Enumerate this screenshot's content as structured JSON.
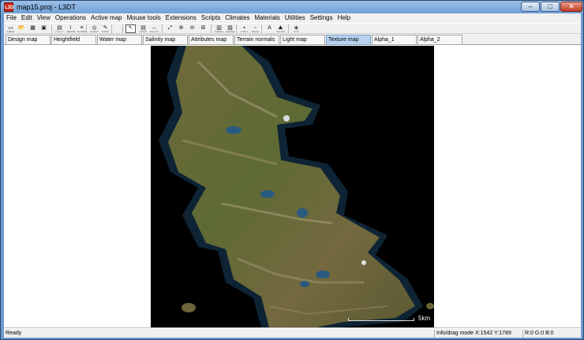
{
  "window": {
    "title": "map15.proj - L3DT",
    "app_icon_label": "L3D",
    "min": "–",
    "max": "□",
    "close": "✕"
  },
  "menu": [
    "File",
    "Edit",
    "View",
    "Operations",
    "Active map",
    "Mouse tools",
    "Extensions",
    "Scripts",
    "Climates",
    "Materials",
    "Utilities",
    "Settings",
    "Help"
  ],
  "toolbar": {
    "buttons": [
      {
        "name": "new-icon",
        "label": "NEW",
        "glyph": "▭"
      },
      {
        "name": "open-icon",
        "label": "",
        "glyph": "📂"
      },
      {
        "name": "save-all-icon",
        "label": "",
        "glyph": "▦"
      },
      {
        "name": "save-icon",
        "label": "",
        "glyph": "▣"
      },
      {
        "name": "calc-icon",
        "label": "CALC",
        "glyph": "▤"
      },
      {
        "name": "graph-icon",
        "label": "GRAPH",
        "glyph": "⌇"
      },
      {
        "name": "script-icon",
        "label": "SCRIPT",
        "glyph": "≡"
      },
      {
        "name": "sync-icon",
        "label": "SYNCH",
        "glyph": "◎"
      },
      {
        "name": "edit-icon",
        "label": "EDIT",
        "glyph": "✎"
      },
      {
        "name": "select-icon",
        "label": "",
        "glyph": "↖"
      },
      {
        "name": "tool-edit-icon",
        "label": "EDIT",
        "glyph": "▤"
      },
      {
        "name": "tool-rule-icon",
        "label": "RULE",
        "glyph": "↔"
      },
      {
        "name": "zoom-fit-icon",
        "label": "",
        "glyph": "⤢"
      },
      {
        "name": "zoom-in-icon",
        "label": "",
        "glyph": "⊕"
      },
      {
        "name": "zoom-out-icon",
        "label": "",
        "glyph": "⊖"
      },
      {
        "name": "zoom-region-icon",
        "label": "",
        "glyph": "⊞"
      },
      {
        "name": "draw-map-icon",
        "label": "DRAW",
        "glyph": "▥"
      },
      {
        "name": "show-map-icon",
        "label": "SHOW",
        "glyph": "▧"
      },
      {
        "name": "cpu-icon",
        "label": "CPU",
        "glyph": "▪"
      },
      {
        "name": "ram-icon",
        "label": "RAM",
        "glyph": "▫"
      },
      {
        "name": "paint-icon",
        "label": "",
        "glyph": "A"
      },
      {
        "name": "tiles-icon",
        "label": "TILES",
        "glyph": "⛰"
      },
      {
        "name": "3d-view-icon",
        "label": "3-D",
        "glyph": "◈"
      }
    ]
  },
  "tabs": [
    "Design map",
    "Heightfield",
    "Water map",
    "Salinity map",
    "Attributes map",
    "Terrain normals",
    "Light map",
    "Texture map",
    "Alpha_1",
    "Alpha_2"
  ],
  "active_tab": "Texture map",
  "map": {
    "scale_label": "5km"
  },
  "status": {
    "left": "Ready",
    "mode": "Info/drag mode X:1542 Y:1789",
    "color": "R:0 G:0 B:0"
  }
}
